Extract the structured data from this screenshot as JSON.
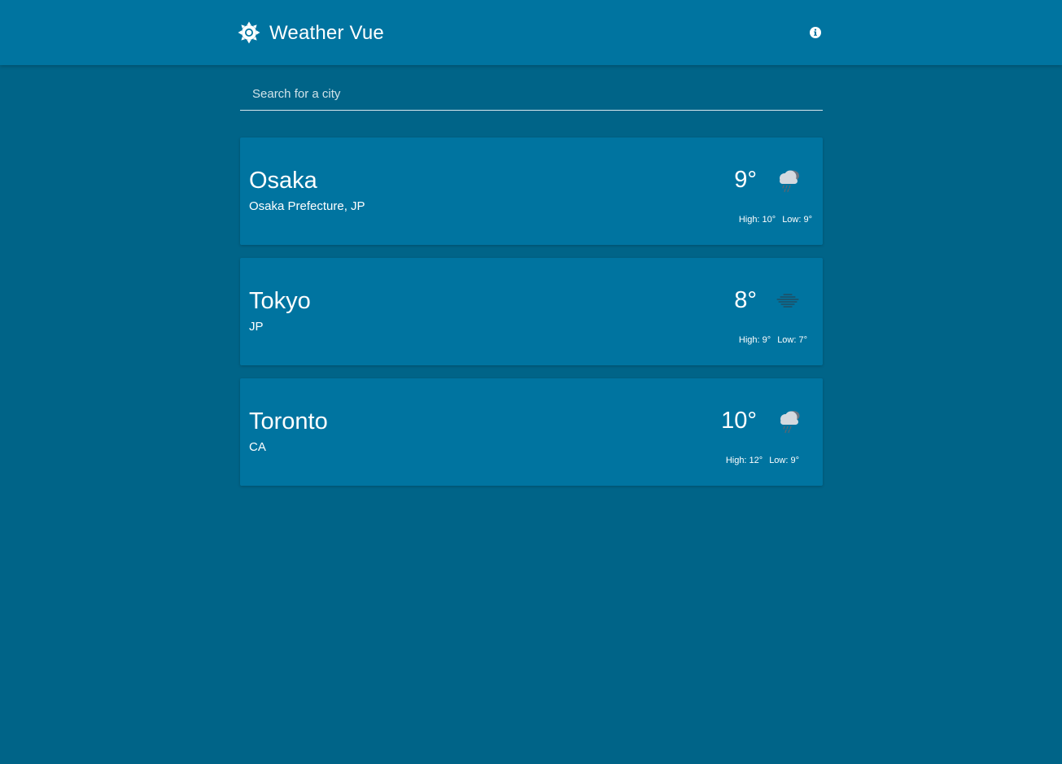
{
  "header": {
    "title": "Weather Vue",
    "logo_icon": "sun-icon",
    "info_icon": "info-icon"
  },
  "search": {
    "placeholder": "Search for a city",
    "value": ""
  },
  "colors": {
    "background": "#006488",
    "surface": "#0074a0",
    "text": "#ffffff",
    "icon_cloud": "#c8ced6",
    "icon_cloud_dark": "#6b7480"
  },
  "cities": [
    {
      "name": "Osaka",
      "region": "Osaka Prefecture, JP",
      "temp": "9°",
      "high": "High: 10°",
      "low": "Low: 9°",
      "icon": "rain-cloud-icon"
    },
    {
      "name": "Tokyo",
      "region": "JP",
      "temp": "8°",
      "high": "High: 9°",
      "low": "Low: 7°",
      "icon": "fog-icon"
    },
    {
      "name": "Toronto",
      "region": "CA",
      "temp": "10°",
      "high": "High: 12°",
      "low": "Low: 9°",
      "icon": "rain-cloud-icon"
    }
  ]
}
